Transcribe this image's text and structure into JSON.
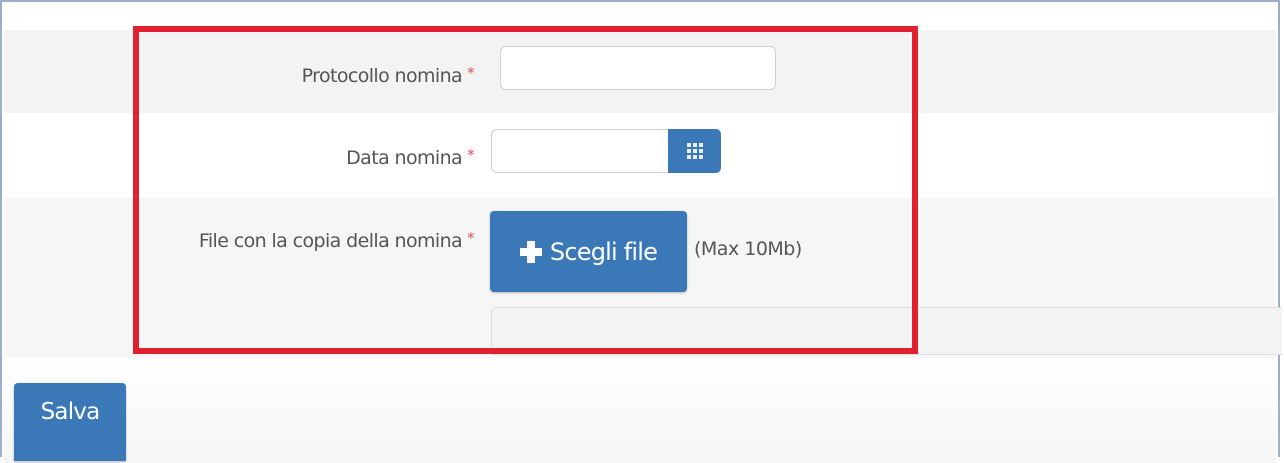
{
  "form": {
    "protocollo": {
      "label": "Protocollo nomina",
      "required_mark": "*",
      "value": ""
    },
    "data": {
      "label": "Data nomina",
      "required_mark": "*",
      "value": "",
      "icon": "calendar-icon"
    },
    "file": {
      "label": "File con la copia della nomina",
      "required_mark": "*",
      "button_label": "Scegli file",
      "button_icon": "plus-icon",
      "max_size_hint": "(Max 10Mb)"
    }
  },
  "actions": {
    "save_label": "Salva"
  },
  "colors": {
    "primary": "#3a78b7",
    "highlight": "#e0212f",
    "required": "#d9534f"
  }
}
